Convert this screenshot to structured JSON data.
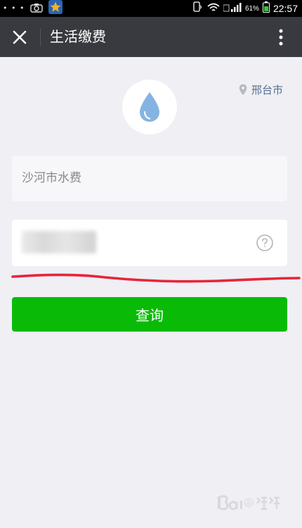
{
  "status_bar": {
    "dots": "• • •",
    "battery": "61%",
    "time": "22:57"
  },
  "header": {
    "title": "生活缴费",
    "icons": [
      "close-icon",
      "more-vertical-icon"
    ]
  },
  "location": {
    "city": "邢台市",
    "icon": "location-pin-icon"
  },
  "logo": {
    "icon": "water-drop-icon",
    "color": "#7fb0e0"
  },
  "form": {
    "company": "沙河市水费",
    "account_value": "",
    "help_icon": "question-circle-icon"
  },
  "query": {
    "label": "查询"
  },
  "colors": {
    "header_bg": "#393a3f",
    "page_bg": "#efeff4",
    "primary_green": "#09bb07",
    "link_blue": "#56708f",
    "annotation_red": "#e8243c"
  }
}
